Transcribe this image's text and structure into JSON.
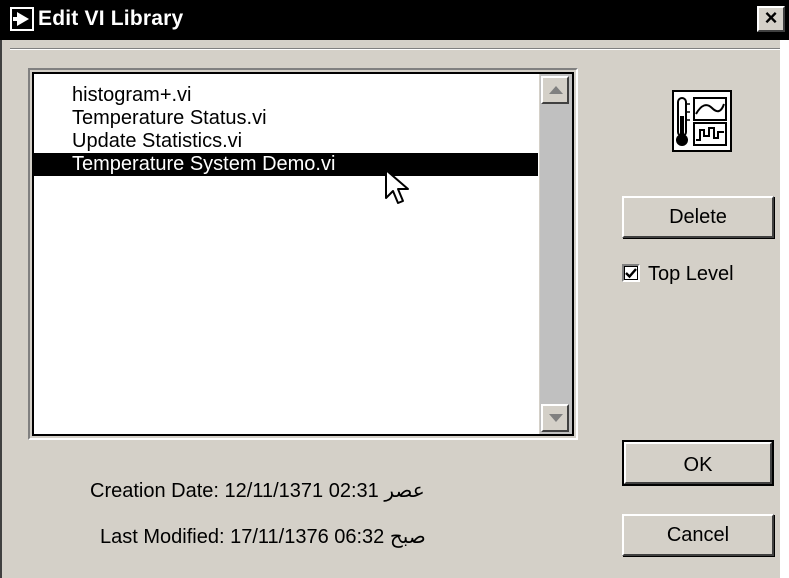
{
  "window": {
    "title": "Edit VI Library",
    "close_glyph": "×"
  },
  "list": {
    "items": [
      {
        "label": "histogram+.vi",
        "selected": false
      },
      {
        "label": "Temperature Status.vi",
        "selected": false
      },
      {
        "label": "Update Statistics.vi",
        "selected": false
      },
      {
        "label": "Temperature System Demo.vi",
        "selected": true
      }
    ]
  },
  "buttons": {
    "delete": "Delete",
    "ok": "OK",
    "cancel": "Cancel"
  },
  "top_level": {
    "label": "Top Level",
    "checked": true
  },
  "info": {
    "creation_label": "Creation Date:",
    "creation_value": "12/11/1371 02:31 عصر",
    "modified_label": "Last Modified:",
    "modified_value": "17/11/1376 06:32 صبح"
  },
  "icons": {
    "vi_icon": "thermometer-graph-icon",
    "title_icon": "labview-run-icon",
    "cursor": "mouse-pointer-icon"
  }
}
